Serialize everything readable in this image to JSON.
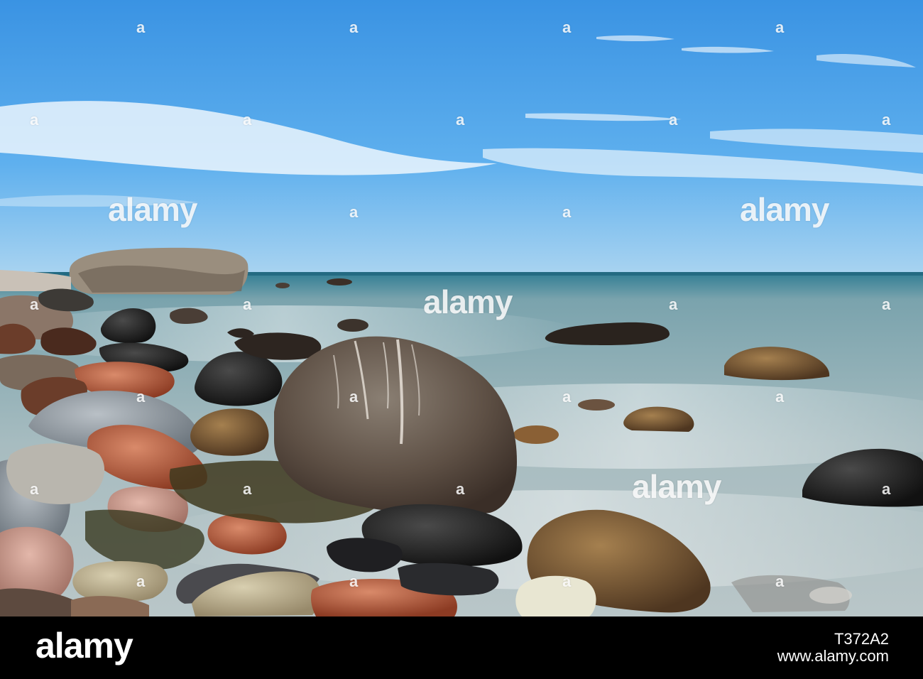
{
  "photo": {
    "description_colors": {
      "sky": "#3f9be6",
      "sea": "#9eb3b8",
      "horizon": "#2a6f8a"
    }
  },
  "watermark": {
    "brand": "alamy",
    "mark": "a"
  },
  "footer": {
    "logo": "alamy",
    "image_id": "T372A2",
    "url": "www.alamy.com"
  }
}
